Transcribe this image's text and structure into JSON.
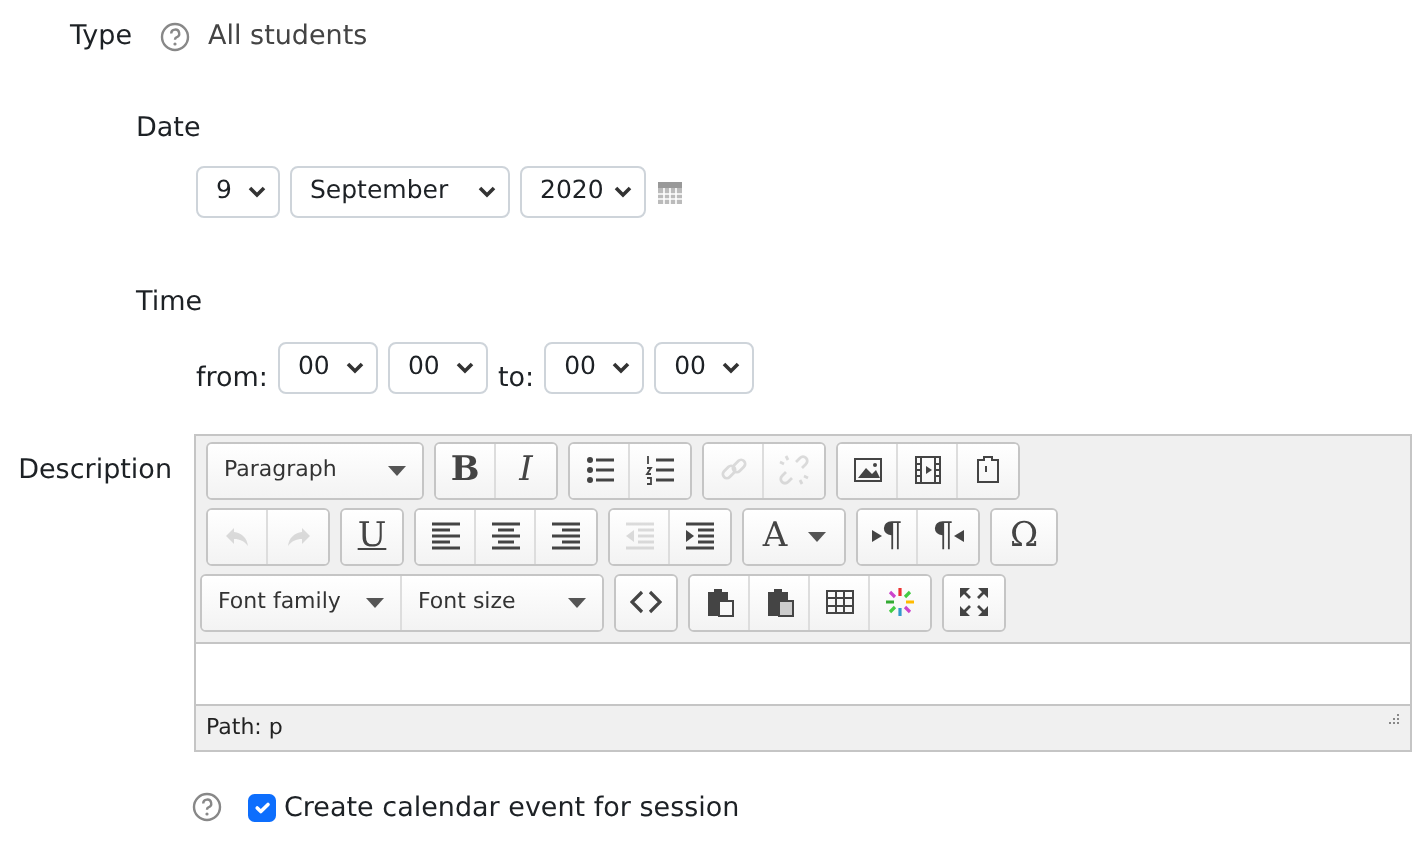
{
  "form": {
    "type": {
      "label": "Type",
      "value": "All students"
    },
    "date": {
      "label": "Date",
      "selects": [
        "9",
        "September",
        "2020"
      ]
    },
    "time": {
      "label": "Time",
      "from_label": "from:",
      "to_label": "to:",
      "from": [
        "00",
        "00"
      ],
      "to": [
        "00",
        "00"
      ]
    },
    "description": {
      "label": "Description",
      "toolbar": [
        [
          [
            {
              "kind": "listbox",
              "label": "Paragraph"
            }
          ],
          [
            {
              "kind": "bold",
              "label": "B",
              "disabled": false
            },
            {
              "kind": "italic",
              "label": "I",
              "disabled": false
            }
          ],
          [
            {
              "kind": "bullets",
              "disabled": false
            },
            {
              "kind": "numbers",
              "disabled": false
            }
          ],
          [
            {
              "kind": "link",
              "disabled": true
            },
            {
              "kind": "unlink",
              "disabled": true
            }
          ],
          [
            {
              "kind": "image",
              "disabled": false
            },
            {
              "kind": "media",
              "disabled": false
            },
            {
              "kind": "template",
              "disabled": false
            }
          ]
        ],
        [
          [
            {
              "kind": "undo",
              "disabled": true
            },
            {
              "kind": "redo",
              "disabled": true
            }
          ],
          [
            {
              "kind": "underline",
              "label": "U",
              "disabled": false
            }
          ],
          [
            {
              "kind": "align-left",
              "disabled": false
            },
            {
              "kind": "align-center",
              "disabled": false
            },
            {
              "kind": "align-right",
              "disabled": false
            }
          ],
          [
            {
              "kind": "outdent",
              "disabled": true
            },
            {
              "kind": "indent",
              "disabled": false
            }
          ],
          [
            {
              "kind": "textcolor",
              "label": "A",
              "disabled": false
            }
          ],
          [
            {
              "kind": "ltr",
              "label": "¶",
              "disabled": false
            },
            {
              "kind": "rtl",
              "label": "¶",
              "disabled": false
            }
          ],
          [
            {
              "kind": "symbol",
              "label": "Ω",
              "disabled": false
            }
          ]
        ],
        [
          [
            {
              "kind": "listbox",
              "label": "Font family"
            },
            {
              "kind": "listbox",
              "label": "Font size"
            }
          ],
          [
            {
              "kind": "code",
              "disabled": false
            }
          ],
          [
            {
              "kind": "paste-text",
              "disabled": false
            },
            {
              "kind": "paste-word",
              "disabled": false
            },
            {
              "kind": "table",
              "disabled": false
            },
            {
              "kind": "sparkle",
              "disabled": false
            }
          ],
          [
            {
              "kind": "fullscreen",
              "disabled": false
            }
          ]
        ]
      ],
      "path": "Path: p"
    },
    "calendar_event": {
      "label": "Create calendar event for session",
      "checked": true
    }
  }
}
